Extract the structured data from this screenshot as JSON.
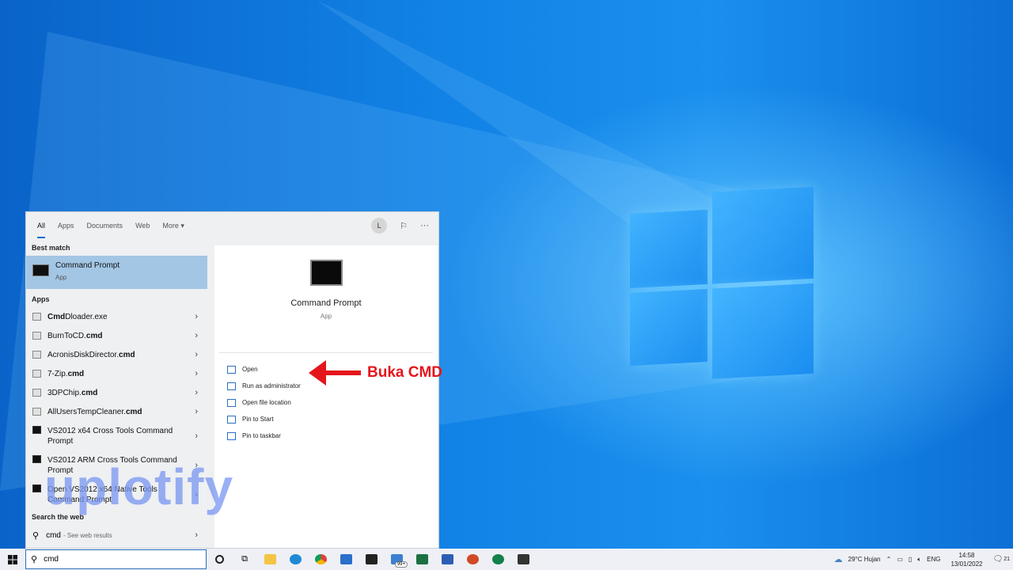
{
  "start_menu": {
    "tabs": [
      "All",
      "Apps",
      "Documents",
      "Web",
      "More ▾"
    ],
    "avatar_letter": "L",
    "best_match_heading": "Best match",
    "best_match": {
      "title": "Command Prompt",
      "subtitle": "App"
    },
    "apps_heading": "Apps",
    "apps": [
      {
        "bold": "Cmd",
        "rest": "Dloader.exe",
        "pre": ""
      },
      {
        "pre": "BurnToCD.",
        "bold": "cmd",
        "rest": ""
      },
      {
        "pre": "AcronisDiskDirector.",
        "bold": "cmd",
        "rest": ""
      },
      {
        "pre": "7-Zip.",
        "bold": "cmd",
        "rest": ""
      },
      {
        "pre": "3DPChip.",
        "bold": "cmd",
        "rest": ""
      },
      {
        "pre": "AllUsersTempCleaner.",
        "bold": "cmd",
        "rest": ""
      }
    ],
    "apps_long": [
      "VS2012 x64 Cross Tools Command Prompt",
      "VS2012 ARM Cross Tools Command Prompt",
      "Open VS2012 x64 Native Tools Command Prompt"
    ],
    "web_heading": "Search the web",
    "web_query": "cmd",
    "web_hint": "- See web results",
    "preview": {
      "title": "Command Prompt",
      "subtitle": "App"
    },
    "actions": [
      "Open",
      "Run as administrator",
      "Open file location",
      "Pin to Start",
      "Pin to taskbar"
    ]
  },
  "callout": "Buka CMD",
  "watermark": "uplotify",
  "taskbar": {
    "search_value": "cmd",
    "mail_badge": "99+",
    "weather": "29°C  Hujan",
    "lang": "ENG",
    "time": "14:58",
    "date": "13/01/2022",
    "notif_count": "21"
  },
  "colors": {
    "accent": "#1a6fd0",
    "best_match_bg": "#a3c6e5",
    "callout": "#e4161c"
  }
}
